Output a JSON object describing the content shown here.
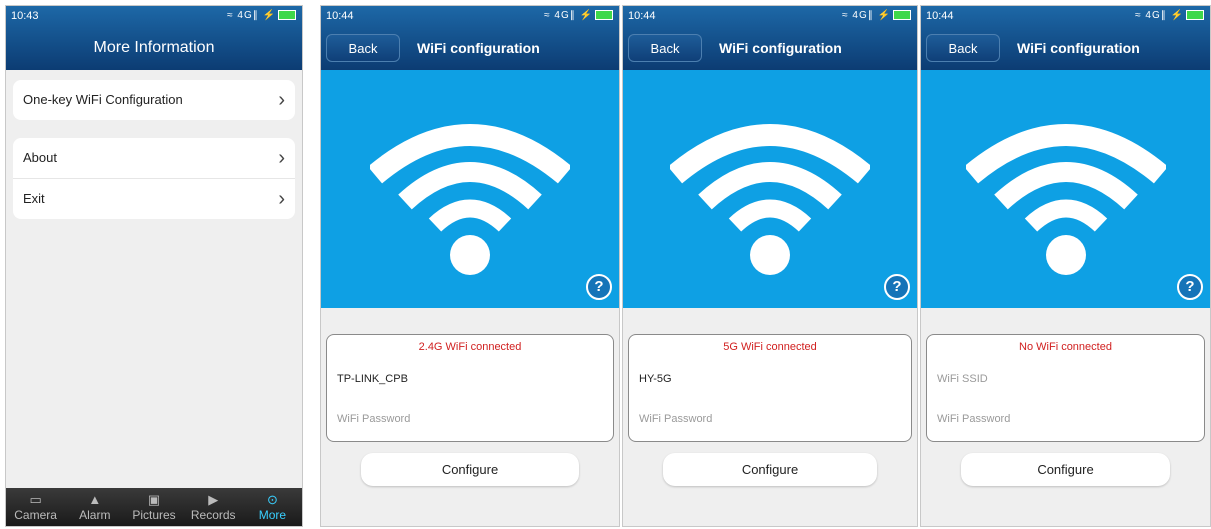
{
  "screen1": {
    "time": "10:43",
    "status_icons": "≈ 4G∥ ⚡",
    "title": "More Information",
    "rows_group1": [
      {
        "label": "One-key WiFi Configuration"
      }
    ],
    "rows_group2": [
      {
        "label": "About"
      },
      {
        "label": "Exit"
      }
    ],
    "tabs": [
      {
        "label": "Camera",
        "icon": "camera-icon",
        "glyph": "▭"
      },
      {
        "label": "Alarm",
        "icon": "bell-icon",
        "glyph": "▲"
      },
      {
        "label": "Pictures",
        "icon": "picture-icon",
        "glyph": "▣"
      },
      {
        "label": "Records",
        "icon": "play-icon",
        "glyph": "▶"
      },
      {
        "label": "More",
        "icon": "more-icon",
        "glyph": "⊙"
      }
    ],
    "active_tab": "More"
  },
  "wifi_screens": [
    {
      "time": "10:44",
      "back": "Back",
      "title": "WiFi configuration",
      "status_msg": "2.4G WiFi connected",
      "ssid": "TP-LINK_CPB",
      "ssid_is_placeholder": false,
      "password_placeholder": "WiFi Password",
      "configure": "Configure"
    },
    {
      "time": "10:44",
      "back": "Back",
      "title": "WiFi configuration",
      "status_msg": "5G WiFi connected",
      "ssid": "HY-5G",
      "ssid_is_placeholder": false,
      "password_placeholder": "WiFi Password",
      "configure": "Configure"
    },
    {
      "time": "10:44",
      "back": "Back",
      "title": "WiFi configuration",
      "status_msg": "No WiFi connected",
      "ssid": "WiFi SSID",
      "ssid_is_placeholder": true,
      "password_placeholder": "WiFi Password",
      "configure": "Configure"
    }
  ],
  "help_glyph": "?",
  "chevron": "›",
  "colors": {
    "header": "#0c3c73",
    "hero": "#0ea0e4",
    "status_red": "#d12020",
    "active_tab": "#39d0ff"
  }
}
